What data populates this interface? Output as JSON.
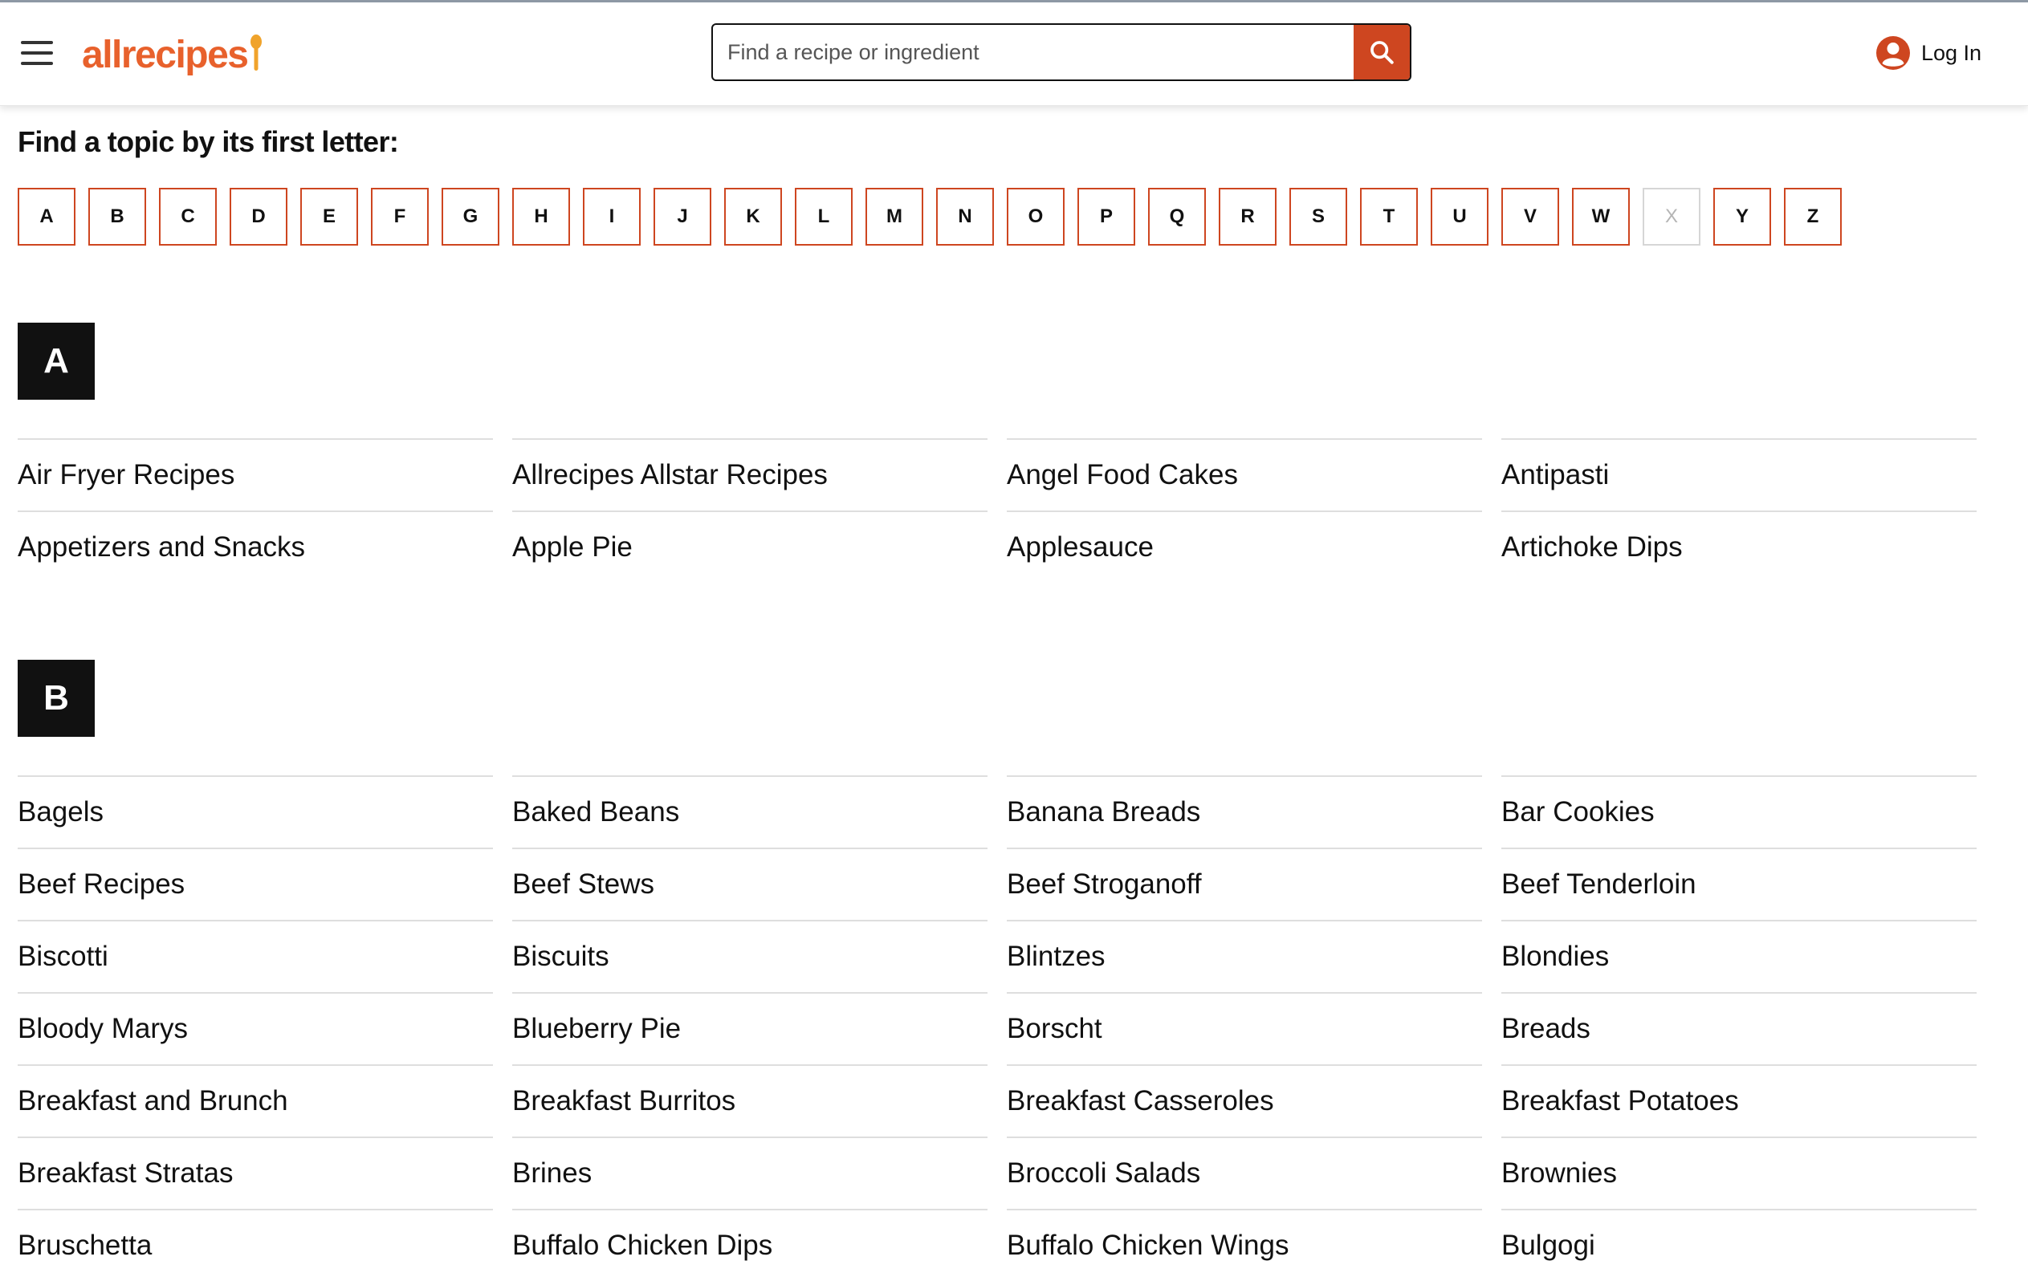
{
  "header": {
    "brand": "allrecipes",
    "search_placeholder": "Find a recipe or ingredient",
    "login_label": "Log In"
  },
  "nav": {
    "title": "Find a topic by its first letter:",
    "letters": [
      {
        "label": "A",
        "enabled": true
      },
      {
        "label": "B",
        "enabled": true
      },
      {
        "label": "C",
        "enabled": true
      },
      {
        "label": "D",
        "enabled": true
      },
      {
        "label": "E",
        "enabled": true
      },
      {
        "label": "F",
        "enabled": true
      },
      {
        "label": "G",
        "enabled": true
      },
      {
        "label": "H",
        "enabled": true
      },
      {
        "label": "I",
        "enabled": true
      },
      {
        "label": "J",
        "enabled": true
      },
      {
        "label": "K",
        "enabled": true
      },
      {
        "label": "L",
        "enabled": true
      },
      {
        "label": "M",
        "enabled": true
      },
      {
        "label": "N",
        "enabled": true
      },
      {
        "label": "O",
        "enabled": true
      },
      {
        "label": "P",
        "enabled": true
      },
      {
        "label": "Q",
        "enabled": true
      },
      {
        "label": "R",
        "enabled": true
      },
      {
        "label": "S",
        "enabled": true
      },
      {
        "label": "T",
        "enabled": true
      },
      {
        "label": "U",
        "enabled": true
      },
      {
        "label": "V",
        "enabled": true
      },
      {
        "label": "W",
        "enabled": true
      },
      {
        "label": "X",
        "enabled": false
      },
      {
        "label": "Y",
        "enabled": true
      },
      {
        "label": "Z",
        "enabled": true
      }
    ]
  },
  "sections": [
    {
      "letter": "A",
      "topics": [
        "Air Fryer Recipes",
        "Allrecipes Allstar Recipes",
        "Angel Food Cakes",
        "Antipasti",
        "Appetizers and Snacks",
        "Apple Pie",
        "Applesauce",
        "Artichoke Dips"
      ]
    },
    {
      "letter": "B",
      "topics": [
        "Bagels",
        "Baked Beans",
        "Banana Breads",
        "Bar Cookies",
        "Beef Recipes",
        "Beef Stews",
        "Beef Stroganoff",
        "Beef Tenderloin",
        "Biscotti",
        "Biscuits",
        "Blintzes",
        "Blondies",
        "Bloody Marys",
        "Blueberry Pie",
        "Borscht",
        "Breads",
        "Breakfast and Brunch",
        "Breakfast Burritos",
        "Breakfast Casseroles",
        "Breakfast Potatoes",
        "Breakfast Stratas",
        "Brines",
        "Broccoli Salads",
        "Brownies",
        "Bruschetta",
        "Buffalo Chicken Dips",
        "Buffalo Chicken Wings",
        "Bulgogi"
      ]
    }
  ],
  "colors": {
    "brand": "#e8612c",
    "accent": "#ce4620",
    "badge": "#111111",
    "divider": "#dedede"
  }
}
